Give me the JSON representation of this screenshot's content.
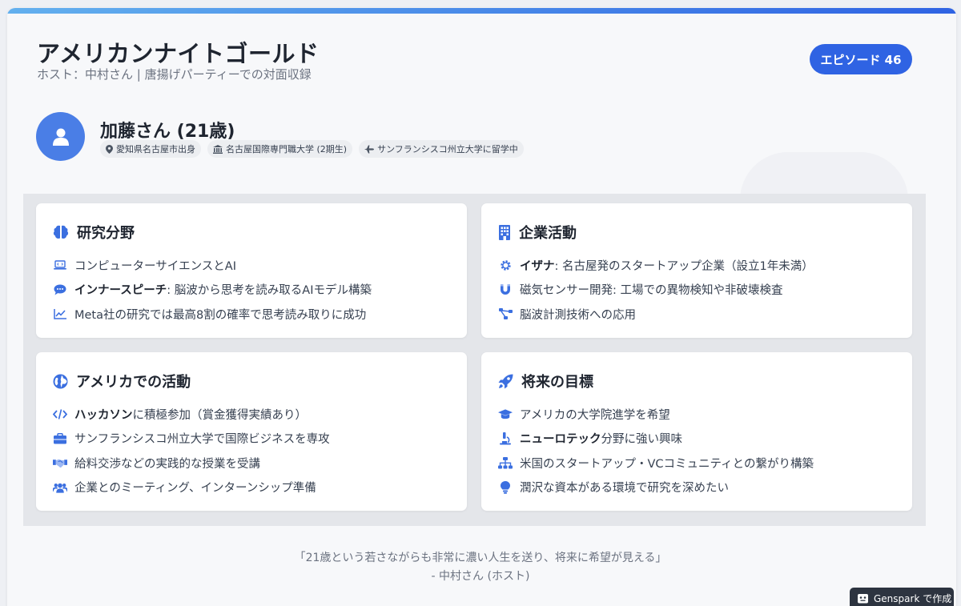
{
  "header": {
    "title": "アメリカンナイトゴールド",
    "subtitle": "ホスト：中村さん | 唐揚げパーティーでの対面収録",
    "episode": "エピソード 46"
  },
  "guest": {
    "name": "加藤さん (21歳)",
    "tags": [
      {
        "icon": "map-pin-icon",
        "label": "愛知県名古屋市出身"
      },
      {
        "icon": "university-icon",
        "label": "名古屋国際専門職大学 (2期生)"
      },
      {
        "icon": "airplane-icon",
        "label": "サンフランシスコ州立大学に留学中"
      }
    ]
  },
  "sections": {
    "research": {
      "title": "研究分野",
      "icon": "brain-icon",
      "items": [
        {
          "icon": "laptop-code-icon",
          "bold": "",
          "text": "コンピューターサイエンスとAI"
        },
        {
          "icon": "speech-bubble-icon",
          "bold": "インナースピーチ",
          "text": ": 脳波から思考を読み取るAIモデル構築"
        },
        {
          "icon": "chart-line-icon",
          "bold": "",
          "text": "Meta社の研究では最高8割の確率で思考読み取りに成功"
        }
      ]
    },
    "business": {
      "title": "企業活動",
      "icon": "building-icon",
      "items": [
        {
          "icon": "gear-icon",
          "bold": "イザナ",
          "text": ": 名古屋発のスタートアップ企業（設立1年未満）"
        },
        {
          "icon": "magnet-icon",
          "bold": "",
          "text": "磁気センサー開発: 工場での異物検知や非破壊検査"
        },
        {
          "icon": "network-icon",
          "bold": "",
          "text": "脳波計測技術への応用"
        }
      ]
    },
    "america": {
      "title": "アメリカでの活動",
      "icon": "globe-icon",
      "items": [
        {
          "icon": "code-icon",
          "bold": "ハッカソン",
          "text": "に積極参加（賞金獲得実績あり）"
        },
        {
          "icon": "briefcase-icon",
          "bold": "",
          "text": "サンフランシスコ州立大学で国際ビジネスを専攻"
        },
        {
          "icon": "handshake-icon",
          "bold": "",
          "text": "給料交渉などの実践的な授業を受講"
        },
        {
          "icon": "users-icon",
          "bold": "",
          "text": "企業とのミーティング、インターンシップ準備"
        }
      ]
    },
    "goals": {
      "title": "将来の目標",
      "icon": "rocket-icon",
      "items": [
        {
          "icon": "graduation-cap-icon",
          "bold": "",
          "text": "アメリカの大学院進学を希望"
        },
        {
          "icon": "microscope-icon",
          "bold": "ニューロテック",
          "text": "分野に強い興味"
        },
        {
          "icon": "sitemap-icon",
          "bold": "",
          "text": "米国のスタートアップ・VCコミュニティとの繋がり構築"
        },
        {
          "icon": "lightbulb-icon",
          "bold": "",
          "text": "潤沢な資本がある環境で研究を深めたい"
        }
      ]
    }
  },
  "quote": {
    "text": "「21歳という若さながらも非常に濃い人生を送り、将来に希望が見える」",
    "author": "- 中村さん (ホスト)"
  },
  "footer_badge": {
    "icon": "robot-icon",
    "label": "Genspark で作成"
  },
  "colors": {
    "accent": "#2f63e3",
    "gradient_start": "#63b0ee",
    "icon_blue": "#3b6fe0",
    "text_dark": "#1f2530",
    "text_muted": "#6b7280"
  }
}
